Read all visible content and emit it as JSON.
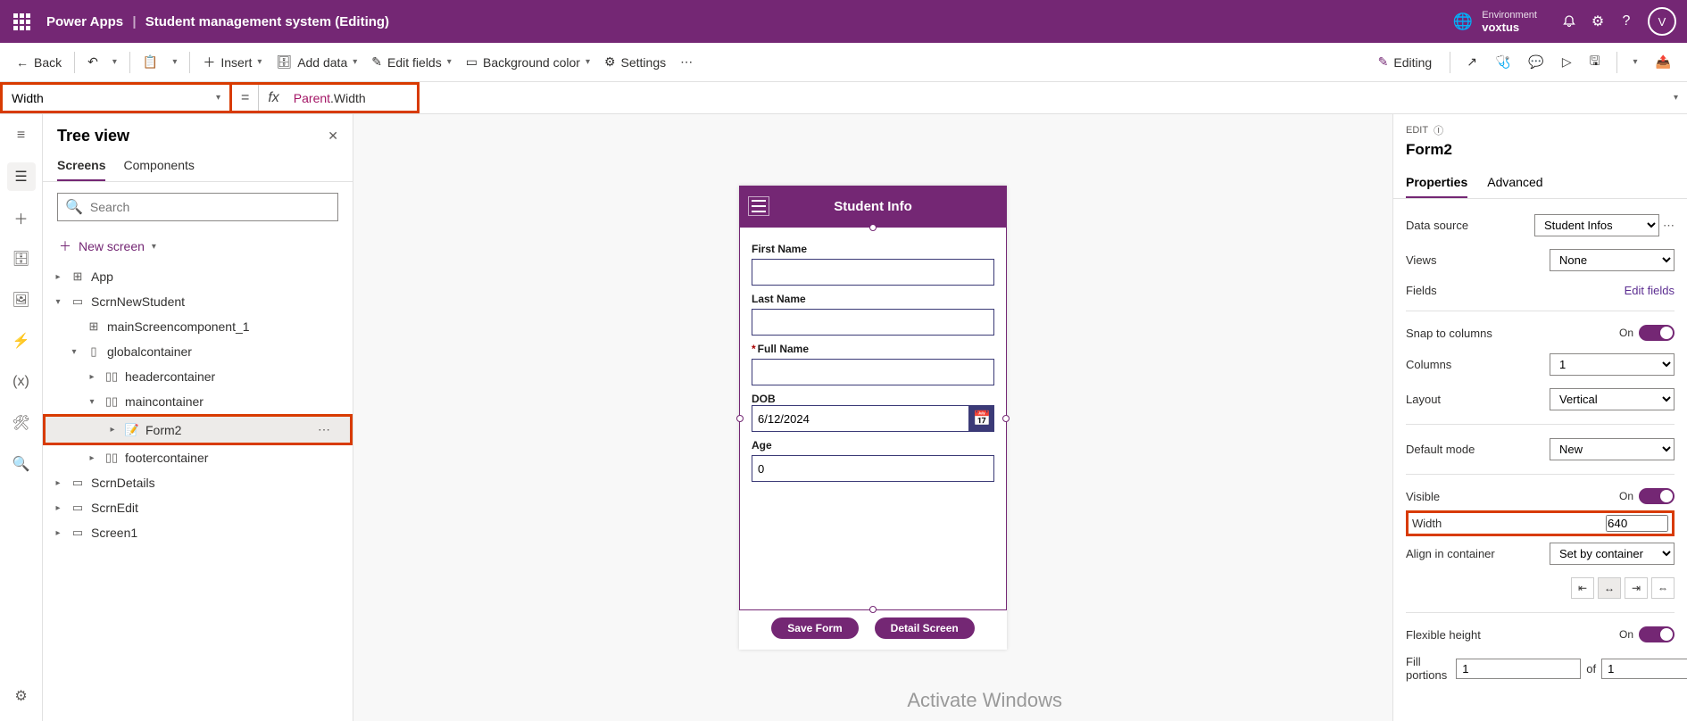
{
  "header": {
    "product": "Power Apps",
    "app_title": "Student management system (Editing)",
    "env_label": "Environment",
    "env_name": "voxtus",
    "avatar_initial": "V"
  },
  "cmdbar": {
    "back": "Back",
    "insert": "Insert",
    "add_data": "Add data",
    "edit_fields": "Edit fields",
    "bg_color": "Background color",
    "settings": "Settings",
    "editing": "Editing"
  },
  "formula": {
    "property": "Width",
    "expr_left": "Parent",
    "expr_right": ".Width"
  },
  "tree": {
    "title": "Tree view",
    "tab_screens": "Screens",
    "tab_components": "Components",
    "search_placeholder": "Search",
    "new_screen": "New screen",
    "nodes": {
      "app": "App",
      "scrn_new": "ScrnNewStudent",
      "main_comp": "mainScreencomponent_1",
      "global": "globalcontainer",
      "headerc": "headercontainer",
      "mainc": "maincontainer",
      "form2": "Form2",
      "footerc": "footercontainer",
      "scrn_details": "ScrnDetails",
      "scrn_edit": "ScrnEdit",
      "screen1": "Screen1"
    }
  },
  "phone": {
    "title": "Student Info",
    "fields": {
      "first_name": "First Name",
      "last_name": "Last Name",
      "full_name": "Full Name",
      "dob": "DOB",
      "dob_value": "6/12/2024",
      "age": "Age",
      "age_value": "0"
    },
    "save_btn": "Save Form",
    "detail_btn": "Detail Screen"
  },
  "props": {
    "edit_label": "EDIT",
    "title": "Form2",
    "tab_properties": "Properties",
    "tab_advanced": "Advanced",
    "data_source_lbl": "Data source",
    "data_source_val": "Student Infos",
    "views_lbl": "Views",
    "views_val": "None",
    "fields_lbl": "Fields",
    "edit_fields_link": "Edit fields",
    "snap_lbl": "Snap to columns",
    "on_lbl": "On",
    "columns_lbl": "Columns",
    "columns_val": "1",
    "layout_lbl": "Layout",
    "layout_val": "Vertical",
    "default_mode_lbl": "Default mode",
    "default_mode_val": "New",
    "visible_lbl": "Visible",
    "width_lbl": "Width",
    "width_val": "640",
    "align_lbl": "Align in container",
    "align_val": "Set by container",
    "flex_h_lbl": "Flexible height",
    "fill_portions_lbl": "Fill portions",
    "fill_val": "1",
    "of_lbl": "of",
    "of_val": "1"
  },
  "watermark": "Activate Windows"
}
